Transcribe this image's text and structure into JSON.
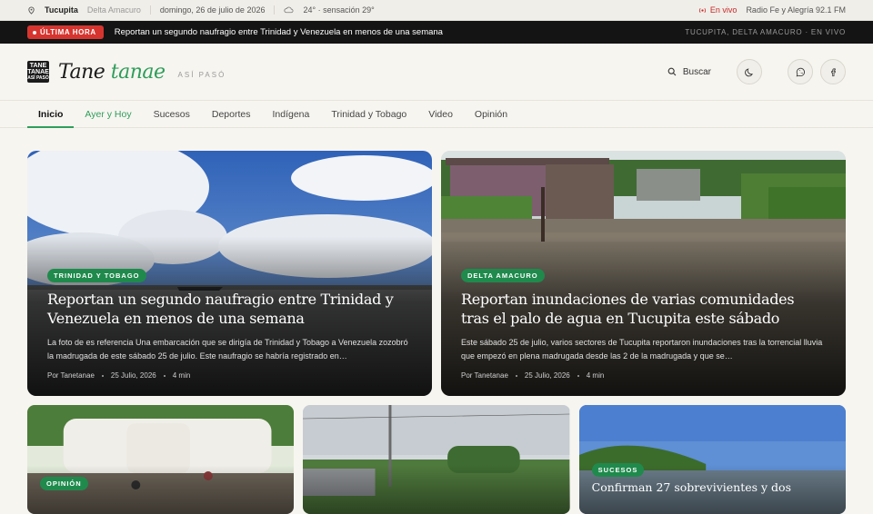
{
  "topbar": {
    "location": "Tucupita",
    "region": "Delta Amacuro",
    "date": "domingo, 26 de julio de 2026",
    "weather": "24° · sensación 29°",
    "live_label": "En vivo",
    "radio": "Radio Fe y Alegría 92.1 FM"
  },
  "breaking": {
    "badge": "ÚLTIMA HORA",
    "headline": "Reportan un segundo naufragio entre Trinidad y Venezuela en menos de una semana",
    "right": "TUCUPITA, DELTA AMACURO · EN VIVO"
  },
  "header": {
    "logo_top": "TANE",
    "logo_mid": "TANAE",
    "logo_bot": "ASÍ PASÓ",
    "brand_a": "Tane",
    "brand_b": "tanae",
    "tagline": "ASÍ PASÓ",
    "search_label": "Buscar"
  },
  "nav": {
    "items": [
      "Inicio",
      "Ayer y Hoy",
      "Sucesos",
      "Deportes",
      "Indígena",
      "Trinidad y Tobago",
      "Video",
      "Opinión"
    ]
  },
  "features": [
    {
      "tag": "TRINIDAD Y TOBAGO",
      "title": "Reportan un segundo naufragio entre Trinidad y Venezuela en menos de una semana",
      "excerpt": "La foto de es referencia Una embarcación que se dirigía de Trinidad y Tobago a Venezuela zozobró la madrugada de este sábado 25 de julio. Este naufragio se habría registrado en…",
      "author": "Por Tanetanae",
      "date": "25 Julio, 2026",
      "read": "4 min"
    },
    {
      "tag": "DELTA AMACURO",
      "title": "Reportan inundaciones de varias comunidades tras el palo de agua en Tucupita este sábado",
      "excerpt": "Este sábado 25 de julio, varios sectores de Tucupita reportaron inundaciones tras la torrencial lluvia que empezó en plena madrugada desde las 2 de la madrugada y que se…",
      "author": "Por Tanetanae",
      "date": "25 Julio, 2026",
      "read": "4 min"
    }
  ],
  "lower": [
    {
      "tag": "OPINIÓN",
      "title": ""
    },
    {
      "tag": "",
      "title": ""
    },
    {
      "tag": "SUCESOS",
      "title": "Confirman 27 sobrevivientes y dos"
    }
  ],
  "colors": {
    "accent_green": "#2e9e5b",
    "breaking_red": "#d6352f",
    "tag_green": "#1f8a4c"
  }
}
